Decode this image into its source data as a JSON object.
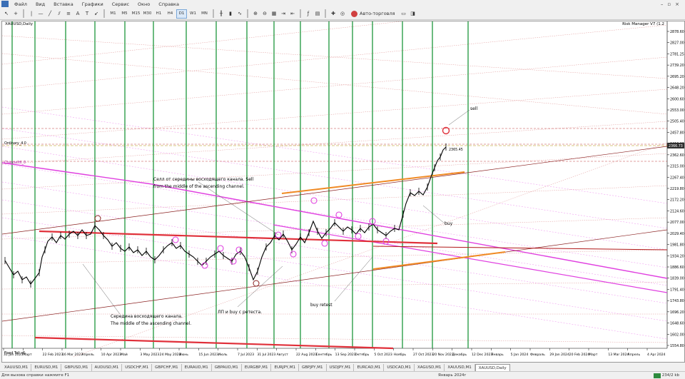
{
  "menu": {
    "items": [
      "Файл",
      "Вид",
      "Вставка",
      "Графики",
      "Сервис",
      "Окно",
      "Справка"
    ],
    "window_buttons": [
      "–",
      "▫",
      "×"
    ]
  },
  "toolbar": {
    "timeframes": [
      "M1",
      "M5",
      "M15",
      "M30",
      "H1",
      "H4",
      "D1",
      "W1",
      "MN"
    ],
    "active_timeframe": "D1",
    "auto_trading_label": "Авто-торговля"
  },
  "chart": {
    "title": "XAUUSD,Daily",
    "indicator_label": "Risk Manager V7 (1.2",
    "current_price": "2366.73",
    "price_tag": "2365.45",
    "left_labels": [
      "Ordinary_4.0",
      "ChannelHi_0"
    ],
    "bottom_left_label": "Fixed Tell x6",
    "y_ticks": [
      "2878.60",
      "2827.00",
      "2781.25",
      "2739.20",
      "2695.20",
      "2648.20",
      "2600.60",
      "2553.00",
      "2505.40",
      "2457.80",
      "2410.20",
      "2362.60",
      "2315.00",
      "2267.40",
      "2219.80",
      "2172.20",
      "2124.60",
      "2077.00",
      "2029.40",
      "1981.80",
      "1934.20",
      "1886.60",
      "1839.00",
      "1791.40",
      "1743.80",
      "1696.20",
      "1648.60",
      "1602.00",
      "1554.80"
    ],
    "x_ticks": [
      "31 Jan 2023",
      "Март",
      "22 Feb 2023",
      "16 Mar 2023",
      "Апрель",
      "10 Apr 2023",
      "Май",
      "3 May 2023",
      "24 May 2023",
      "Июнь",
      "15 Jun 2023",
      "Июль",
      "7 Jul 2023",
      "31 Jul 2023",
      "Август",
      "22 Aug 2023",
      "Сентябрь",
      "13 Sep 2023",
      "Октябрь",
      "5 Oct 2023",
      "Ноябрь",
      "27 Oct 2023",
      "20 Nov 2023",
      "Декабрь",
      "12 Dec 2023",
      "Январь",
      "5 Jan 2024",
      "Февраль",
      "29 Jan 2024",
      "20 Feb 2024",
      "Март",
      "13 Mar 2024",
      "Апрель",
      "4 Apr 2024"
    ],
    "annotations": {
      "sell_top": "sell",
      "sell_mid_ru": "Селл от середины восходящего канала. Sell",
      "sell_mid_en": "from the middle of the ascending channel.",
      "buy": "buy",
      "middle_ru": "Середина восходящего канала.",
      "middle_en": "The middle of the ascending channel.",
      "lp_buy": "ЛП и buy с ретеста.",
      "buy_retest": "buy retest"
    }
  },
  "tabs": {
    "items": [
      "XAUUSD,M1",
      "EURUSD,M1",
      "GBPUSD,M1",
      "AUDUSD,M1",
      "USDCHF,M1",
      "GBPCHF,M1",
      "EURAUD,M1",
      "GBPAUD,M1",
      "EURGBP,M1",
      "EURJPY,M1",
      "GBPJPY,M1",
      "USDJPY,M1",
      "EURCAD,M1",
      "USDCAD,M1",
      "XAGUSD,M1",
      "XAUUSD,M1",
      "XAUUSD,Daily"
    ],
    "active": "XAUUSD,Daily"
  },
  "status": {
    "help": "Для вызова справки нажмите F1",
    "date": "Январь 2024г",
    "traffic": "234/2 kb"
  },
  "colors": {
    "green_grid": "#2e9e4a",
    "red_line": "#e0303a",
    "orange_line": "#f08a24",
    "magenta_line": "#e040e0",
    "candle": "#000000",
    "accent": "#3b6fb6"
  }
}
